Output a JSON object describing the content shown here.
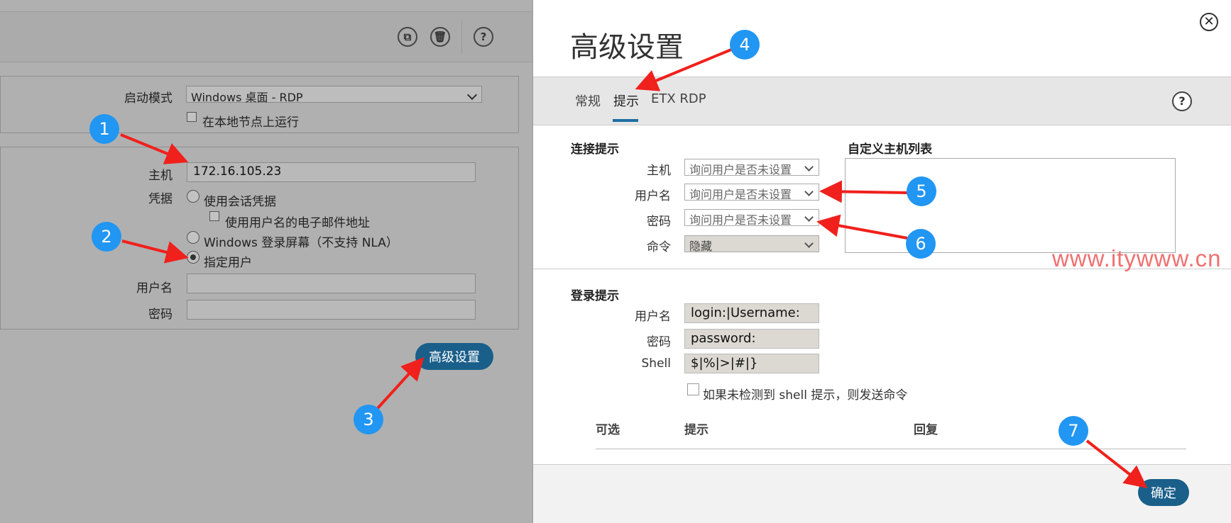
{
  "left_form": {
    "launch_mode_label": "启动模式",
    "launch_mode_value": "Windows 桌面 - RDP",
    "run_local_label": "在本地节点上运行",
    "host_label": "主机",
    "host_value": "172.16.105.23",
    "credentials_label": "凭据",
    "cred_option_session": "使用会话凭据",
    "cred_option_email": "使用用户名的电子邮件地址",
    "cred_option_login_screen": "Windows 登录屏幕（不支持 NLA）",
    "cred_option_specific_user": "指定用户",
    "username_label": "用户名",
    "password_label": "密码",
    "advanced_button": "高级设置"
  },
  "toolbar_icons": [
    "copy-icon",
    "trash-icon",
    "help-icon"
  ],
  "dialog": {
    "title": "高级设置",
    "tabs": [
      {
        "label": "常规",
        "active": false
      },
      {
        "label": "提示",
        "active": true
      },
      {
        "label": "ETX RDP",
        "active": false
      }
    ],
    "connection_prompts": {
      "title": "连接提示",
      "rows": [
        {
          "label": "主机",
          "value": "询问用户是否未设置"
        },
        {
          "label": "用户名",
          "value": "询问用户是否未设置"
        },
        {
          "label": "密码",
          "value": "询问用户是否未设置"
        },
        {
          "label": "命令",
          "value": "隐藏"
        }
      ]
    },
    "custom_host_list_title": "自定义主机列表",
    "login_prompts": {
      "title": "登录提示",
      "rows": [
        {
          "label": "用户名",
          "value": "login:|Username:"
        },
        {
          "label": "密码",
          "value": "password:"
        },
        {
          "label": "Shell",
          "value": "$|%|>|#|}"
        }
      ],
      "send_cmd_checkbox": "如果未检测到 shell 提示，则发送命令"
    },
    "table_headers": [
      "可选",
      "提示",
      "回复"
    ],
    "ok_button": "确定"
  },
  "annotations": [
    "1",
    "2",
    "3",
    "4",
    "5",
    "6",
    "7"
  ],
  "watermark": "www.itywww.cn",
  "colors": {
    "accent": "#1a5f8a",
    "badge": "#2196f3",
    "arrow": "#f0201c",
    "tab_underline": "#1d6fa3"
  }
}
